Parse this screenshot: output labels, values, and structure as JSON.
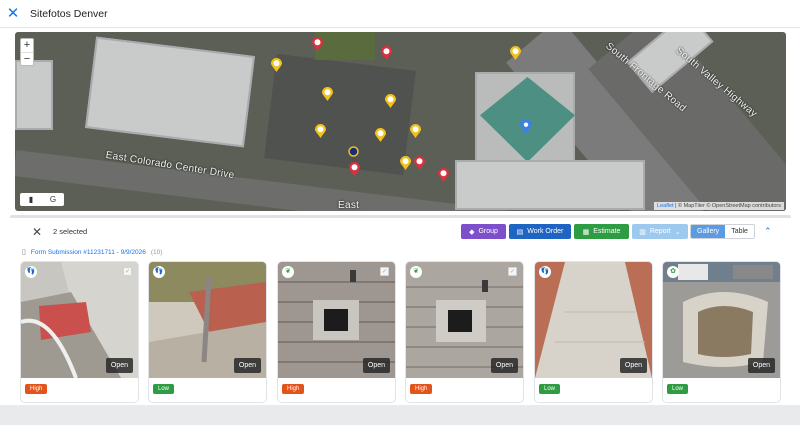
{
  "window": {
    "title": "Sitefotos Denver"
  },
  "map": {
    "zoom_in": "+",
    "zoom_out": "−",
    "streets": [
      "East Colorado Center Drive",
      "South Frontage Road",
      "South Valley Highway",
      "East"
    ],
    "layer_buttons": [
      "▮",
      "G"
    ],
    "attribution_leaflet": "Leaflet",
    "attribution_rest": " | © MapTiler © OpenStreetMap contributors"
  },
  "toolbar": {
    "selected": "2 selected",
    "group": "Group",
    "work_order": "Work Order",
    "estimate": "Estimate",
    "report": "Report",
    "gallery": "Gallery",
    "table": "Table"
  },
  "form": {
    "link": "Form Submission #11231711 - 9/9/2026",
    "count": "(10)"
  },
  "cards": [
    {
      "priority": "High",
      "open": "Open",
      "category": "footsteps-icon"
    },
    {
      "priority": "Low",
      "open": "Open",
      "category": "footsteps-icon"
    },
    {
      "priority": "High",
      "open": "Open",
      "category": "leaf-icon"
    },
    {
      "priority": "High",
      "open": "Open",
      "category": "leaf-icon"
    },
    {
      "priority": "Low",
      "open": "Open",
      "category": "footsteps-icon"
    },
    {
      "priority": "Low",
      "open": "Open",
      "category": "plant-icon"
    }
  ],
  "colors": {
    "accent": "#1a73e8",
    "group": "#7d4fcb",
    "work_order": "#1f64c2",
    "estimate": "#2e9c43",
    "report": "#9ec9ef",
    "high": "#e2541b",
    "low": "#2e9c43"
  }
}
